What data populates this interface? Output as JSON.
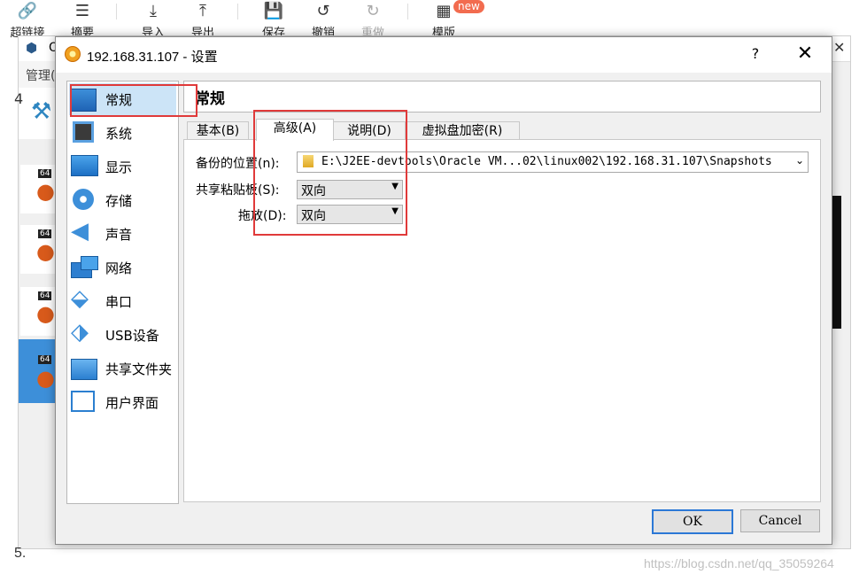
{
  "toolbar": {
    "items": [
      {
        "label": "超链接",
        "icon": "link-icon"
      },
      {
        "label": "摘要",
        "icon": "summary-icon"
      },
      {
        "label": "导入",
        "icon": "import-icon"
      },
      {
        "label": "导出",
        "icon": "export-icon"
      },
      {
        "label": "保存",
        "icon": "save-icon"
      },
      {
        "label": "撤销",
        "icon": "undo-icon"
      },
      {
        "label": "重做",
        "icon": "redo-icon"
      },
      {
        "label": "模版",
        "icon": "template-icon"
      }
    ],
    "new_badge": "new"
  },
  "manager": {
    "title_prefix": "O",
    "menu_label": "管理(",
    "vm_badge": "64",
    "side_num": "4"
  },
  "dialog": {
    "title": "192.168.31.107 - 设置",
    "help": "?",
    "close": "✕",
    "categories": [
      {
        "label": "常规",
        "icon": "general-icon"
      },
      {
        "label": "系统",
        "icon": "system-chip-icon"
      },
      {
        "label": "显示",
        "icon": "display-monitor-icon"
      },
      {
        "label": "存储",
        "icon": "storage-disc-icon"
      },
      {
        "label": "声音",
        "icon": "speaker-icon"
      },
      {
        "label": "网络",
        "icon": "network-icon"
      },
      {
        "label": "串口",
        "icon": "serial-port-icon"
      },
      {
        "label": "USB设备",
        "icon": "usb-icon"
      },
      {
        "label": "共享文件夹",
        "icon": "shared-folder-icon"
      },
      {
        "label": "用户界面",
        "icon": "user-interface-icon"
      }
    ],
    "selected_category": "常规",
    "section_title": "常规",
    "tabs": [
      "基本(B)",
      "高级(A)",
      "说明(D)",
      "虚拟盘加密(R)"
    ],
    "active_tab": "高级(A)",
    "fields": {
      "snapshot_label": "备份的位置(n):",
      "snapshot_value": "E:\\J2EE-devtools\\Oracle VM...02\\linux002\\192.168.31.107\\Snapshots",
      "clipboard_label": "共享粘贴板(S):",
      "clipboard_value": "双向",
      "dragdrop_label": "拖放(D):",
      "dragdrop_value": "双向"
    },
    "ok": "OK",
    "cancel": "Cancel"
  },
  "page": {
    "step_label": "5.",
    "watermark": "https://blog.csdn.net/qq_35059264"
  },
  "colors": {
    "highlight_red": "#e03a3a",
    "selection": "#cce4f7",
    "ok_border": "#2b78d6"
  }
}
